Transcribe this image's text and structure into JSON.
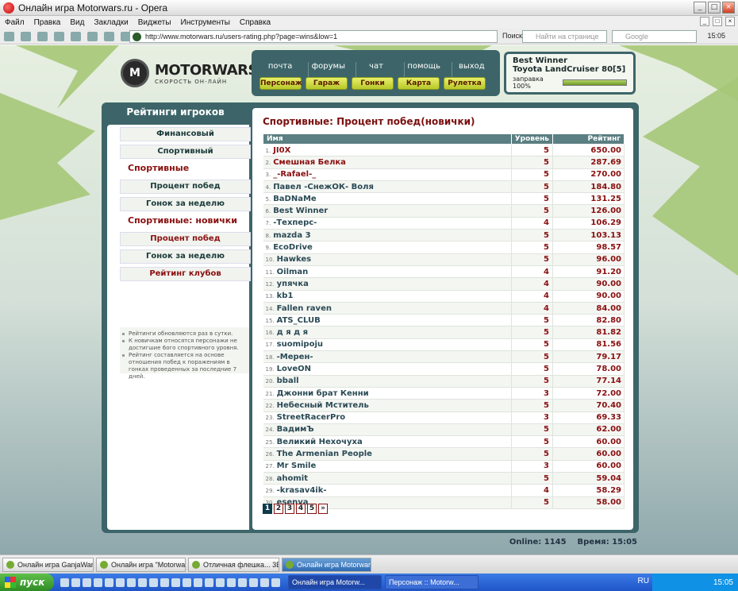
{
  "window": {
    "title": "Онлайн игра Motorwars.ru - Opera"
  },
  "menu": [
    "Файл",
    "Правка",
    "Вид",
    "Закладки",
    "Виджеты",
    "Инструменты",
    "Справка"
  ],
  "address": {
    "url": "http://www.motorwars.ru/users-rating.php?page=wins&low=1",
    "go_label": "Поиск",
    "find_placeholder": "Найти на странице",
    "google_placeholder": "Google",
    "time": "15:05"
  },
  "site": {
    "logo_text": "MOTORWARS.RU",
    "logo_sub": "СКОРОСТЬ ОН-ЛАЙН",
    "logo_mark": "M"
  },
  "nav_top": [
    "почта",
    "форумы",
    "чат",
    "помощь",
    "выход"
  ],
  "nav_buttons": [
    "Персонаж",
    "Гараж",
    "Гонки",
    "Карта",
    "Рулетка"
  ],
  "player": {
    "name": "Best Winner",
    "car": "Toyota LandCruiser 80[5]",
    "fuel_label": "заправка 100%",
    "fuel": 1.0
  },
  "left": {
    "title": "Рейтинги игроков",
    "items": [
      "Финансовый",
      "Спортивный",
      "Спортивные",
      "Процент побед",
      "Гонок за неделю",
      "Спортивные: новички",
      "Процент побед",
      "Гонок за неделю",
      "Рейтинг клубов"
    ],
    "notes": [
      "Рейтинги обновляются раз в сутки.",
      "К новичкам относятся персонажи не достигшие 6ого спортивного уровня.",
      "Рейтинг составляется на основе отношения побед к поражениям в гонках проведенных за последние 7 дней."
    ]
  },
  "main": {
    "title": "Спортивные: Процент побед(новички)",
    "headers": [
      "Имя",
      "Уровень",
      "Рейтинг"
    ],
    "rows": [
      [
        "JI0X",
        "5",
        "650.00"
      ],
      [
        "Смешная Белка",
        "5",
        "287.69"
      ],
      [
        "_-Rafael-_",
        "5",
        "270.00"
      ],
      [
        "Павел -СнежОК- Воля",
        "5",
        "184.80"
      ],
      [
        "BaDNaMe",
        "5",
        "131.25"
      ],
      [
        "Best Winner",
        "5",
        "126.00"
      ],
      [
        "-Техперс-",
        "4",
        "106.29"
      ],
      [
        "mazda 3",
        "5",
        "103.13"
      ],
      [
        "EcoDrive",
        "5",
        "98.57"
      ],
      [
        "Hawkes",
        "5",
        "96.00"
      ],
      [
        "Oilman",
        "4",
        "91.20"
      ],
      [
        "упячка",
        "4",
        "90.00"
      ],
      [
        "kb1",
        "4",
        "90.00"
      ],
      [
        "Fallen raven",
        "4",
        "84.00"
      ],
      [
        "ATS_CLUB",
        "5",
        "82.80"
      ],
      [
        "д я д я",
        "5",
        "81.82"
      ],
      [
        "suomipoju",
        "5",
        "81.56"
      ],
      [
        "-Мерен-",
        "5",
        "79.17"
      ],
      [
        "LoveON",
        "5",
        "78.00"
      ],
      [
        "bball",
        "5",
        "77.14"
      ],
      [
        "Джонни брат Кенни",
        "3",
        "72.00"
      ],
      [
        "Небесный Мститель",
        "5",
        "70.40"
      ],
      [
        "StreetRacerPro",
        "3",
        "69.33"
      ],
      [
        "ВадимЪ",
        "5",
        "62.00"
      ],
      [
        "Великий Нехочуха",
        "5",
        "60.00"
      ],
      [
        "The Armenian People",
        "5",
        "60.00"
      ],
      [
        "Mr Smile",
        "3",
        "60.00"
      ],
      [
        "ahomit",
        "5",
        "59.04"
      ],
      [
        "-krasav4ik-",
        "4",
        "58.29"
      ],
      [
        "esenya",
        "5",
        "58.00"
      ]
    ],
    "pages": [
      "1",
      "2",
      "3",
      "4",
      "5",
      "»"
    ]
  },
  "footer": {
    "online": "Online: 1145",
    "time": "Время: 15:05"
  },
  "tabs": [
    "Онлайн игра GanjaWars...",
    "Онлайн игра \"Motorwars\"",
    "Отличная флешка... 3В...",
    "Онлайн игра Motorwars.ru"
  ],
  "taskbar": {
    "start": "пуск",
    "items": [
      "Онлайн игра Motorw...",
      "Персонаж :: Motorw..."
    ],
    "lang": "RU",
    "clock": "15:05"
  }
}
